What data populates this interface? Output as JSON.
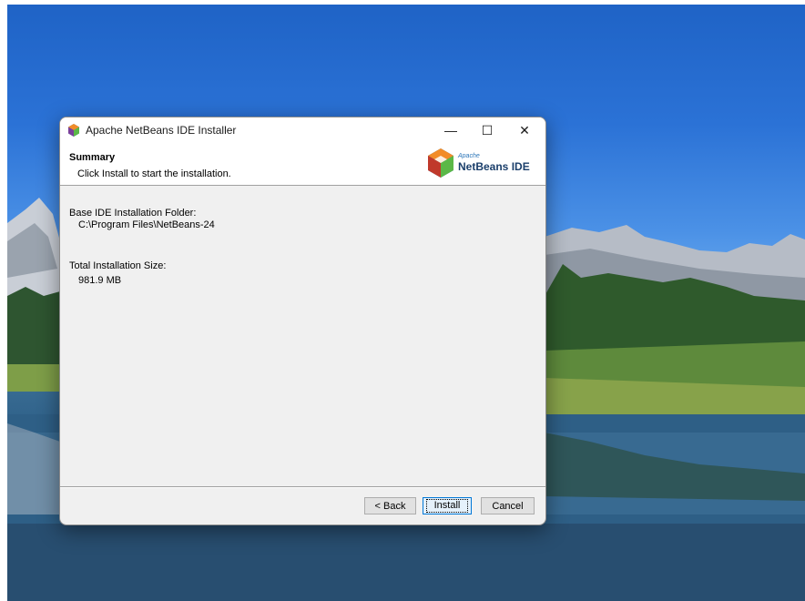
{
  "window": {
    "title": "Apache NetBeans IDE Installer",
    "controls": {
      "minimize": "—",
      "maximize": "☐",
      "close": "✕"
    }
  },
  "header": {
    "title": "Summary",
    "subtitle": "Click Install to start the installation.",
    "logo_small": "Apache",
    "logo_big": "NetBeans IDE"
  },
  "summary": {
    "folder_label": "Base IDE Installation Folder:",
    "folder_value": "C:\\Program Files\\NetBeans-24",
    "size_label": "Total Installation Size:",
    "size_value": "981.9 MB"
  },
  "buttons": {
    "back": "< Back",
    "install": "Install",
    "cancel": "Cancel"
  },
  "colors": {
    "accent": "#0078d7",
    "logo_orange": "#f28c28",
    "logo_green": "#5bb847",
    "logo_blue": "#2a74b8",
    "logo_purple": "#7a3f9a"
  }
}
